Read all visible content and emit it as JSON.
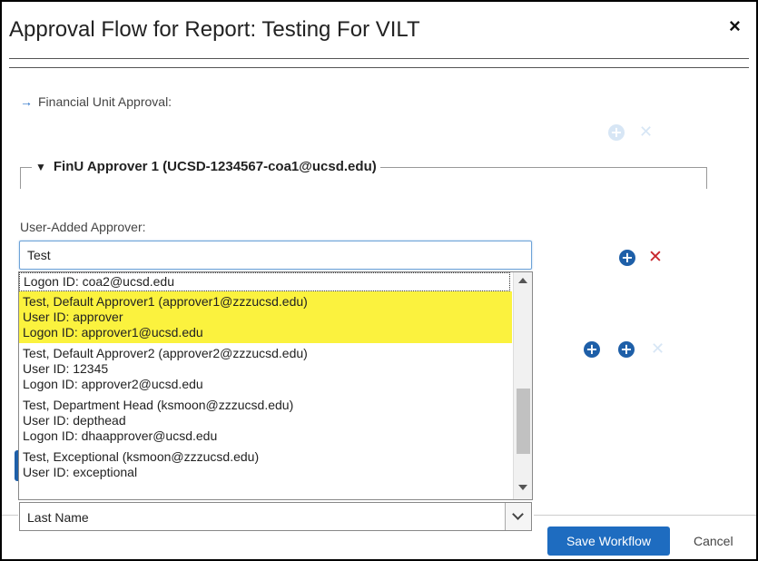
{
  "dialog": {
    "title": "Approval Flow for Report: Testing For VILT",
    "close_glyph": "×"
  },
  "financial_unit": {
    "label": "Financial Unit Approval:",
    "arrow": "→"
  },
  "approver_step": {
    "toggle": "▼",
    "title": "FinU Approver 1 (UCSD-1234567-coa1@ucsd.edu)"
  },
  "user_added": {
    "label": "User-Added Approver:",
    "input_value": "Test"
  },
  "icons": {
    "add": "+",
    "remove": "✕"
  },
  "dropdown": {
    "items": [
      {
        "lines": [
          "Logon ID: coa2@ucsd.edu"
        ],
        "highlighted": false
      },
      {
        "lines": [
          "Test, Default Approver1 (approver1@zzzucsd.edu)",
          "User ID: approver",
          "Logon ID: approver1@ucsd.edu"
        ],
        "highlighted": true
      },
      {
        "lines": [
          "Test, Default Approver2 (approver2@zzzucsd.edu)",
          "User ID: 12345",
          "Logon ID: approver2@ucsd.edu"
        ],
        "highlighted": false
      },
      {
        "lines": [
          "Test, Department Head (ksmoon@zzzucsd.edu)",
          "User ID: depthead",
          "Logon ID: dhaapprover@ucsd.edu"
        ],
        "highlighted": false
      },
      {
        "lines": [
          "Test, Exceptional (ksmoon@zzzucsd.edu)",
          "User ID: exceptional"
        ],
        "highlighted": false
      }
    ]
  },
  "search_by": {
    "selected": "Last Name"
  },
  "footer": {
    "save_label": "Save Workflow",
    "cancel_label": "Cancel"
  },
  "colors": {
    "primary": "#1e6cc0",
    "highlight": "#fbf23e",
    "remove_red": "#c8262c"
  }
}
